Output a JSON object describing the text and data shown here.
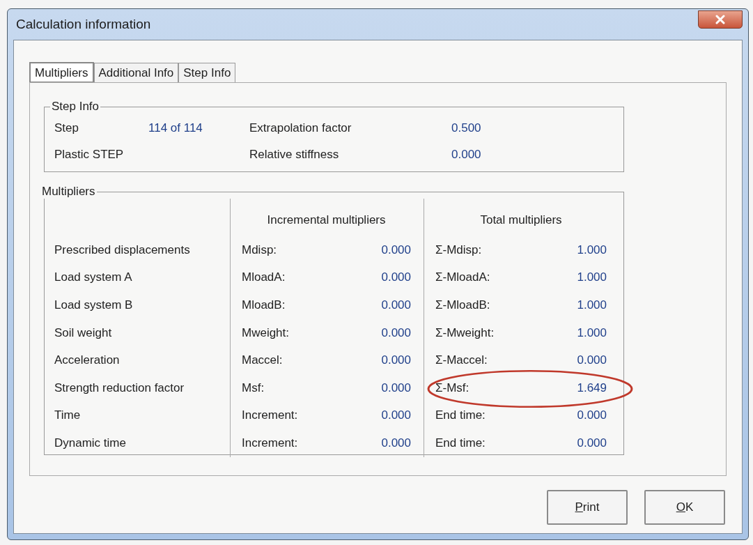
{
  "window": {
    "title": "Calculation information"
  },
  "tabs": [
    {
      "label": "Multipliers",
      "selected": true
    },
    {
      "label": "Additional Info",
      "selected": false
    },
    {
      "label": "Step Info",
      "selected": false
    }
  ],
  "step_info": {
    "title": "Step Info",
    "rows": [
      {
        "label": "Step",
        "value": "114 of 114",
        "label_2": "Extrapolation factor",
        "value_2": "0.500"
      },
      {
        "label": "Plastic STEP",
        "label_2": "Relative stiffness",
        "value_2": "0.000"
      }
    ]
  },
  "multipliers": {
    "title": "Multipliers",
    "columns": [
      "Incremental multipliers",
      "Total multipliers"
    ],
    "rows": [
      {
        "label": "Prescribed displacements",
        "inc_name": "Mdisp:",
        "inc_value": "0.000",
        "total_name": "Σ-Mdisp:",
        "total_value": "1.000",
        "highlighted": false
      },
      {
        "label": "Load system A",
        "inc_name": "MloadA:",
        "inc_value": "0.000",
        "total_name": "Σ-MloadA:",
        "total_value": "1.000",
        "highlighted": false
      },
      {
        "label": "Load system B",
        "inc_name": "MloadB:",
        "inc_value": "0.000",
        "total_name": "Σ-MloadB:",
        "total_value": "1.000",
        "highlighted": false
      },
      {
        "label": "Soil weight",
        "inc_name": "Mweight:",
        "inc_value": "0.000",
        "total_name": "Σ-Mweight:",
        "total_value": "1.000",
        "highlighted": false
      },
      {
        "label": "Acceleration",
        "inc_name": "Maccel:",
        "inc_value": "0.000",
        "total_name": "Σ-Maccel:",
        "total_value": "0.000",
        "highlighted": false
      },
      {
        "label": "Strength reduction factor",
        "inc_name": "Msf:",
        "inc_value": "0.000",
        "total_name": "Σ-Msf:",
        "total_value": "1.649",
        "highlighted": true
      },
      {
        "label": "Time",
        "inc_name": "Increment:",
        "inc_value": "0.000",
        "total_name": "End time:",
        "total_value": "0.000",
        "highlighted": false
      },
      {
        "label": "Dynamic time",
        "inc_name": "Increment:",
        "inc_value": "0.000",
        "total_name": "End time:",
        "total_value": "0.000",
        "highlighted": false
      }
    ]
  },
  "buttons": [
    {
      "label": "Print"
    },
    {
      "label": "OK"
    }
  ]
}
